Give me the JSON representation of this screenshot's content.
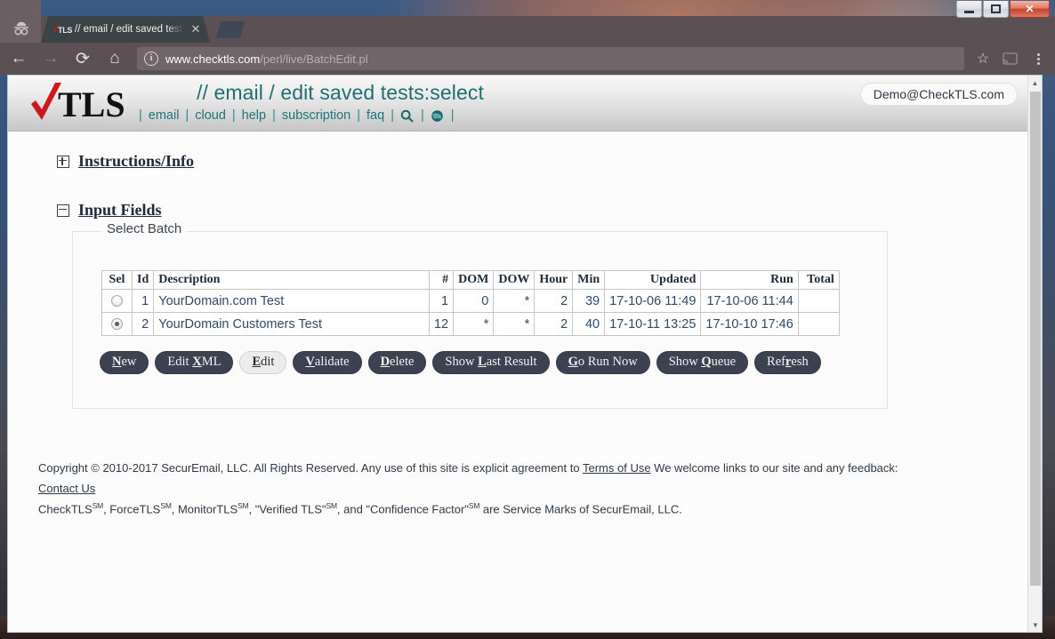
{
  "window": {
    "controls": {
      "minimize": "minimize-button",
      "maximize": "maximize-button",
      "close_label": "✕"
    }
  },
  "browser": {
    "incognito_icon": "incognito-icon",
    "tab": {
      "title": "// email / edit saved tests",
      "close_label": "✕",
      "favicon_check": "✓",
      "favicon_text": "TLS"
    },
    "toolbar": {
      "back_label": "←",
      "forward_label": "→",
      "reload_label": "⟳",
      "home_label": "⌂",
      "info_label": "i",
      "url_host": "www.checktls.com",
      "url_path": "/perl/live/BatchEdit.pl",
      "star_label": "☆",
      "cast_icon": "cast-icon",
      "menu_icon": "three-dot-menu-icon"
    }
  },
  "site": {
    "logo": {
      "check": "✓",
      "text": "TLS"
    },
    "page_heading": "// email / edit saved tests:select",
    "account": "Demo@CheckTLS.com",
    "nav": [
      {
        "label": "email",
        "type": "link"
      },
      {
        "label": "cloud",
        "type": "link"
      },
      {
        "label": "help",
        "type": "link"
      },
      {
        "label": "subscription",
        "type": "link"
      },
      {
        "label": "faq",
        "type": "link"
      },
      {
        "label": "search-icon",
        "type": "icon"
      },
      {
        "label": "globe-icon",
        "type": "icon"
      }
    ],
    "nav_separator": "|"
  },
  "sections": {
    "instructions": {
      "label": "Instructions/Info",
      "state": "collapsed",
      "toggle": "+"
    },
    "input_fields": {
      "label": "Input Fields",
      "state": "expanded",
      "toggle": "−"
    }
  },
  "panel": {
    "legend": "Select Batch"
  },
  "table": {
    "columns": [
      {
        "key": "sel",
        "label": "Sel",
        "align": "center"
      },
      {
        "key": "id",
        "label": "Id",
        "align": "right"
      },
      {
        "key": "desc",
        "label": "Description",
        "align": "left"
      },
      {
        "key": "num",
        "label": "#",
        "align": "right"
      },
      {
        "key": "dom",
        "label": "DOM",
        "align": "right"
      },
      {
        "key": "dow",
        "label": "DOW",
        "align": "right"
      },
      {
        "key": "hour",
        "label": "Hour",
        "align": "right"
      },
      {
        "key": "min",
        "label": "Min",
        "align": "right"
      },
      {
        "key": "updated",
        "label": "Updated",
        "align": "right"
      },
      {
        "key": "run",
        "label": "Run",
        "align": "right"
      },
      {
        "key": "total",
        "label": "Total",
        "align": "right"
      }
    ],
    "rows": [
      {
        "selected": false,
        "id": "1",
        "desc": "YourDomain.com Test",
        "num": "1",
        "dom": "0",
        "dow": "*",
        "hour": "2",
        "min": "39",
        "updated": "17-10-06 11:49",
        "run": "17-10-06 11:44",
        "total": ""
      },
      {
        "selected": true,
        "id": "2",
        "desc": "YourDomain Customers Test",
        "num": "12",
        "dom": "*",
        "dow": "*",
        "hour": "2",
        "min": "40",
        "updated": "17-10-11 13:25",
        "run": "17-10-10 17:46",
        "total": ""
      }
    ]
  },
  "buttons": [
    {
      "name": "new",
      "pre": "",
      "accel": "N",
      "post": "ew",
      "active": false
    },
    {
      "name": "edit-xml",
      "pre": "Edit ",
      "accel": "X",
      "post": "ML",
      "active": false
    },
    {
      "name": "edit",
      "pre": "",
      "accel": "E",
      "post": "dit",
      "active": true
    },
    {
      "name": "validate",
      "pre": "",
      "accel": "V",
      "post": "alidate",
      "active": false
    },
    {
      "name": "delete",
      "pre": "",
      "accel": "D",
      "post": "elete",
      "active": false
    },
    {
      "name": "show-last-result",
      "pre": "Show ",
      "accel": "L",
      "post": "ast Result",
      "active": false
    },
    {
      "name": "go-run-now",
      "pre": "",
      "accel": "G",
      "post": "o Run Now",
      "active": false
    },
    {
      "name": "show-queue",
      "pre": "Show ",
      "accel": "Q",
      "post": "ueue",
      "active": false
    },
    {
      "name": "refresh",
      "pre": "Ref",
      "accel": "r",
      "post": "esh",
      "active": false
    }
  ],
  "footer": {
    "line1_a": "Copyright © 2010-2017 SecurEmail, LLC. All Rights Reserved. Any use of this site is explicit agreement to ",
    "terms_link": "Terms of Use",
    "line1_b": " We welcome links to our site and any feedback:",
    "contact_link": "Contact Us",
    "line3_a": "CheckTLS",
    "sm1": "SM",
    "line3_b": ", ForceTLS",
    "sm2": "SM",
    "line3_c": ", MonitorTLS",
    "sm3": "SM",
    "line3_d": ", \"Verified TLS\"",
    "sm4": "SM",
    "line3_e": ", and \"Confidence Factor\"",
    "sm5": "SM",
    "line3_f": " are Service Marks of SecurEmail, LLC."
  },
  "scrollbar": {
    "up": "▲",
    "down": "▼"
  },
  "colors": {
    "accent_teal": "#1f7478",
    "logo_red": "#cc1a1a",
    "button_dark": "#3d4250",
    "text_blue": "#2f4a66"
  }
}
